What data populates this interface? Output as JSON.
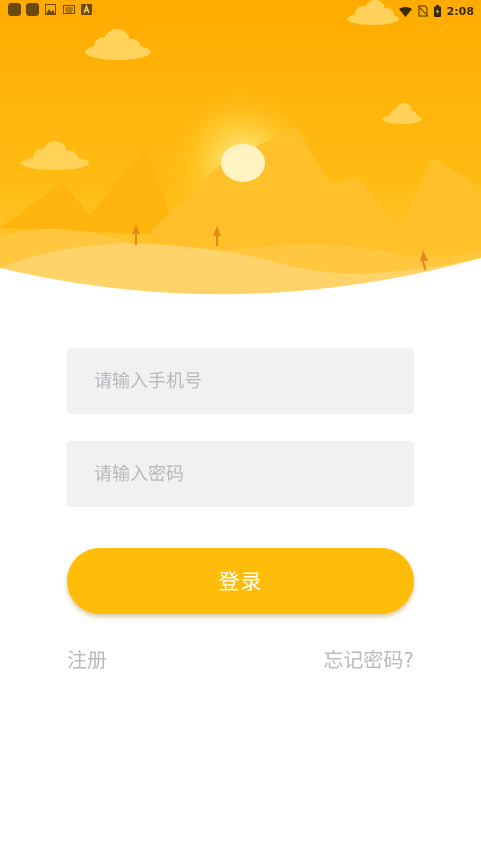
{
  "status_bar": {
    "time": "2:08",
    "left_icons": [
      "app-icon",
      "app-icon",
      "image-icon",
      "keyboard-icon",
      "font-icon"
    ],
    "right_icons": [
      "wifi-icon",
      "no-sim-icon",
      "battery-charging-icon"
    ]
  },
  "form": {
    "phone_placeholder": "请输入手机号",
    "password_placeholder": "请输入密码",
    "login_label": "登录"
  },
  "links": {
    "register": "注册",
    "forgot_password": "忘记密码?"
  },
  "colors": {
    "accent": "#ffbd0a",
    "input_bg": "#f1f1f1",
    "placeholder": "#b7b7bd",
    "link": "#b8b8be"
  }
}
